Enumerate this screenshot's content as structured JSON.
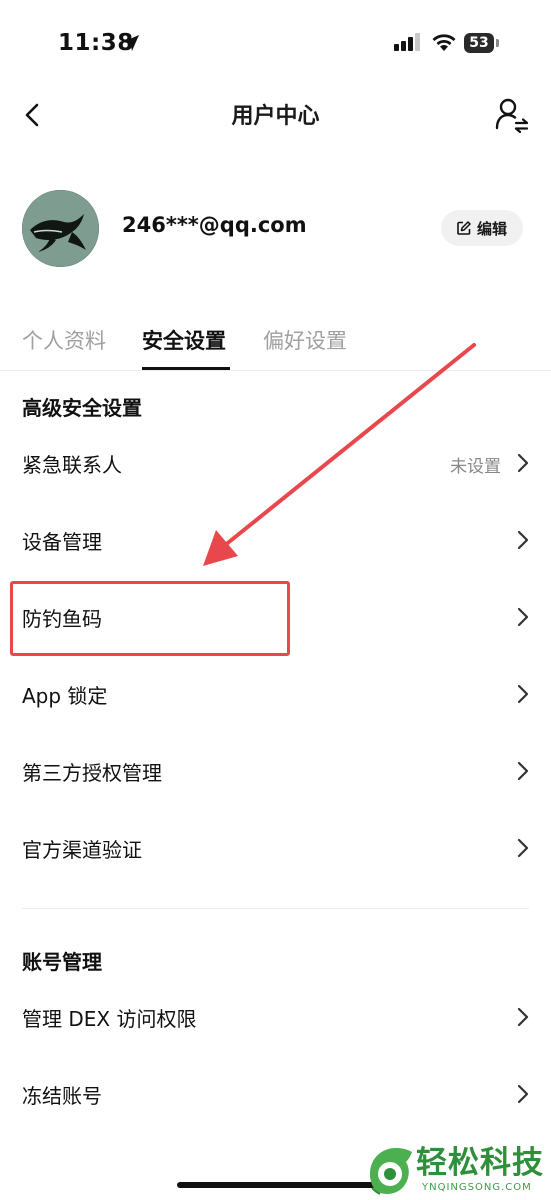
{
  "status_bar": {
    "time": "11:38",
    "battery": "53",
    "icons": [
      "location-arrow-icon",
      "cellular-signal-icon",
      "wifi-icon",
      "battery-icon"
    ]
  },
  "nav": {
    "title": "用户中心",
    "back_icon": "chevron-left-icon",
    "right_icon": "user-switch-icon"
  },
  "profile": {
    "email": "246***@qq.com",
    "edit_label": "编辑",
    "edit_icon": "edit-icon"
  },
  "tabs": [
    {
      "label": "个人资料",
      "active": false
    },
    {
      "label": "安全设置",
      "active": true
    },
    {
      "label": "偏好设置",
      "active": false
    }
  ],
  "sections": [
    {
      "title": "高级安全设置",
      "items": [
        {
          "label": "紧急联系人",
          "value": "未设置"
        },
        {
          "label": "设备管理"
        },
        {
          "label": "防钓鱼码"
        },
        {
          "label": "App 锁定"
        },
        {
          "label": "第三方授权管理"
        },
        {
          "label": "官方渠道验证"
        }
      ]
    },
    {
      "title": "账号管理",
      "items": [
        {
          "label": "管理 DEX 访问权限"
        },
        {
          "label": "冻结账号"
        }
      ]
    }
  ],
  "annotation": {
    "color": "#e8474c",
    "highlighted_item": "防钓鱼码"
  },
  "watermark": {
    "text": "轻松科技",
    "sub": "YNQINGSONG.COM",
    "color": "#2f8f3a"
  }
}
